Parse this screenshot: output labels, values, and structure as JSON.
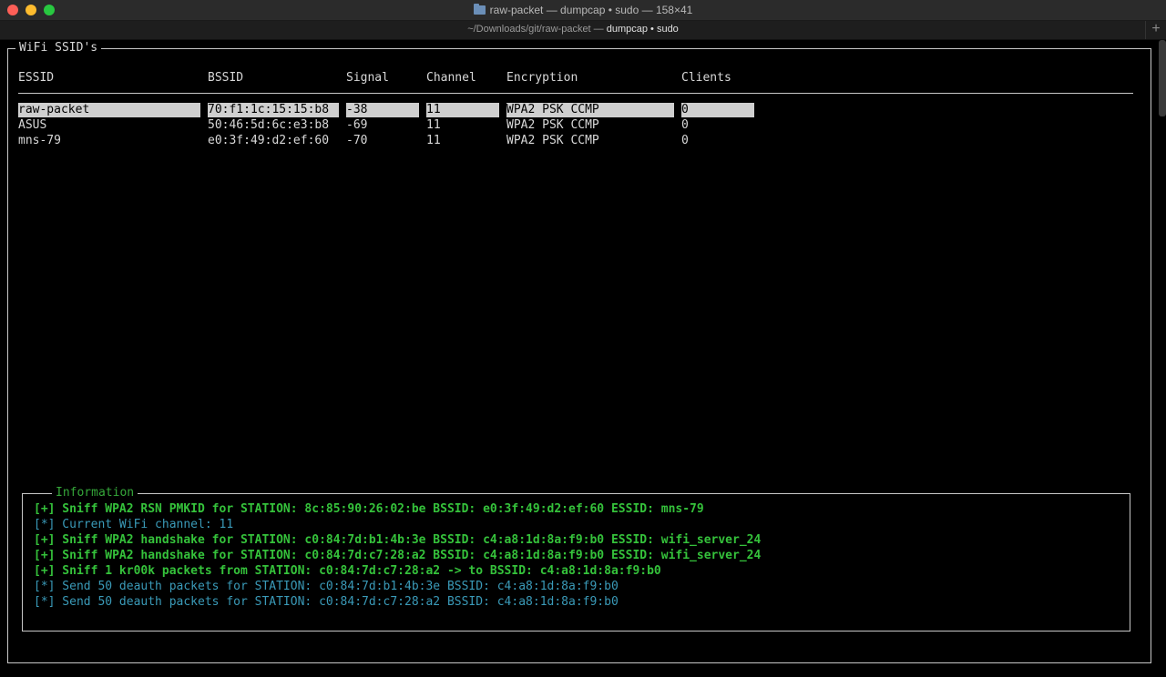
{
  "window": {
    "title": "raw-packet — dumpcap • sudo — 158×41",
    "tab_path": "~/Downloads/git/raw-packet — ",
    "tab_process": "dumpcap • sudo",
    "new_tab": "+"
  },
  "ssid_panel": {
    "title": "WiFi SSID's",
    "headers": [
      "ESSID",
      "BSSID",
      "Signal",
      "Channel",
      "Encryption",
      "Clients"
    ],
    "rows": [
      {
        "essid": "raw-packet",
        "bssid": "70:f1:1c:15:15:b8",
        "signal": "-38",
        "channel": "11",
        "encryption": "WPA2 PSK CCMP",
        "clients": "0",
        "selected": true
      },
      {
        "essid": "ASUS",
        "bssid": "50:46:5d:6c:e3:b8",
        "signal": "-69",
        "channel": "11",
        "encryption": "WPA2 PSK CCMP",
        "clients": "0",
        "selected": false
      },
      {
        "essid": "mns-79",
        "bssid": "e0:3f:49:d2:ef:60",
        "signal": "-70",
        "channel": "11",
        "encryption": "WPA2 PSK CCMP",
        "clients": "0",
        "selected": false
      }
    ]
  },
  "info_panel": {
    "title": "Information",
    "lines": [
      {
        "text": "[+] Sniff WPA2 RSN PMKID for STATION: 8c:85:90:26:02:be BSSID: e0:3f:49:d2:ef:60 ESSID: mns-79",
        "kind": "success"
      },
      {
        "text": "[*] Current WiFi channel: 11",
        "kind": "info"
      },
      {
        "text": "[+] Sniff WPA2 handshake for STATION: c0:84:7d:b1:4b:3e BSSID: c4:a8:1d:8a:f9:b0 ESSID: wifi_server_24",
        "kind": "success"
      },
      {
        "text": "[+] Sniff WPA2 handshake for STATION: c0:84:7d:c7:28:a2 BSSID: c4:a8:1d:8a:f9:b0 ESSID: wifi_server_24",
        "kind": "success"
      },
      {
        "text": "[+] Sniff 1 kr00k packets from STATION: c0:84:7d:c7:28:a2 -> to BSSID: c4:a8:1d:8a:f9:b0",
        "kind": "success"
      },
      {
        "text": "[*] Send 50 deauth packets for STATION: c0:84:7d:b1:4b:3e BSSID: c4:a8:1d:8a:f9:b0",
        "kind": "info"
      },
      {
        "text": "[*] Send 50 deauth packets for STATION: c0:84:7d:c7:28:a2 BSSID: c4:a8:1d:8a:f9:b0",
        "kind": "info"
      }
    ]
  },
  "colors": {
    "success": "#35c23b",
    "info": "#3a9ab8",
    "selection": "#cfcfcf"
  }
}
